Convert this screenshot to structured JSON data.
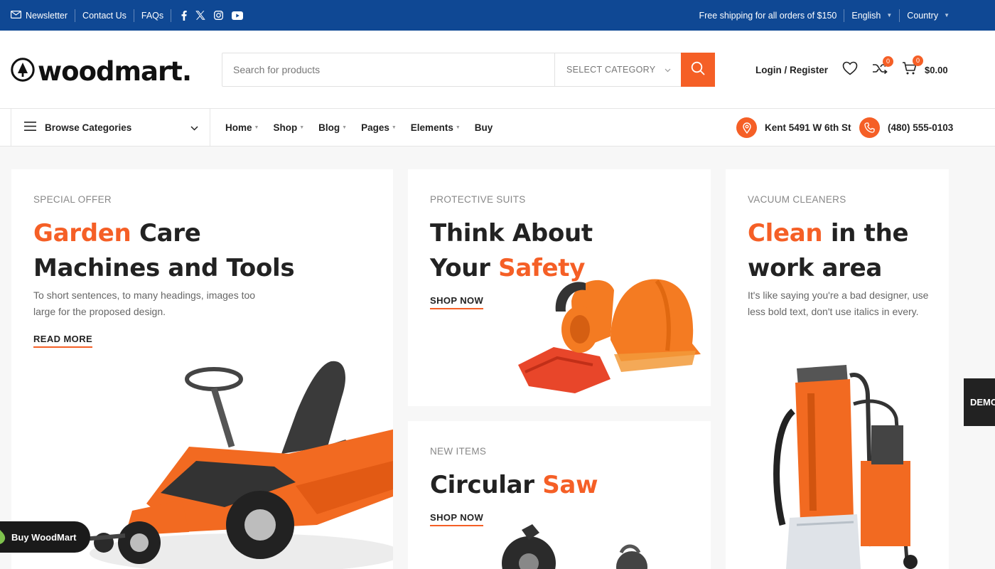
{
  "topbar": {
    "newsletter": "Newsletter",
    "contact_us": "Contact Us",
    "faqs": "FAQs",
    "shipping": "Free shipping for all orders of $150",
    "language": "English",
    "country": "Country"
  },
  "header": {
    "logo": "woodmart.",
    "search_placeholder": "Search for products",
    "category": "SELECT CATEGORY",
    "login": "Login / Register",
    "compare_count": "0",
    "cart_count": "0",
    "cart_total": "$0.00"
  },
  "nav": {
    "browse": "Browse Categories",
    "items": [
      "Home",
      "Shop",
      "Blog",
      "Pages",
      "Elements",
      "Buy"
    ],
    "address": "Kent 5491 W 6th St",
    "phone": "(480) 555-0103"
  },
  "cards": {
    "garden": {
      "subtitle": "SPECIAL OFFER",
      "title_accent": "Garden",
      "title_rest": " Care",
      "title_line2": "Machines and Tools",
      "description": "To short sentences, to many headings, images too large for the proposed design.",
      "link": "READ MORE"
    },
    "safety": {
      "subtitle": "PROTECTIVE SUITS",
      "title_line1": "Think About",
      "title_line2a": "Your ",
      "title_accent": "Safety",
      "link": "SHOP NOW"
    },
    "saw": {
      "subtitle": "NEW ITEMS",
      "title_plain": "Circular ",
      "title_accent": "Saw",
      "link": "SHOP NOW"
    },
    "clean": {
      "subtitle": "VACUUM CLEANERS",
      "title_accent": "Clean",
      "title_rest": " in the",
      "title_line2": "work area",
      "description": "It's like saying you're a bad designer, use less bold text, don't use italics in every.",
      "link": ""
    }
  },
  "floating": {
    "demo": "DEMO",
    "buy": "Buy WoodMart"
  },
  "colors": {
    "topbar": "#0f4894",
    "accent": "#f55f26"
  }
}
